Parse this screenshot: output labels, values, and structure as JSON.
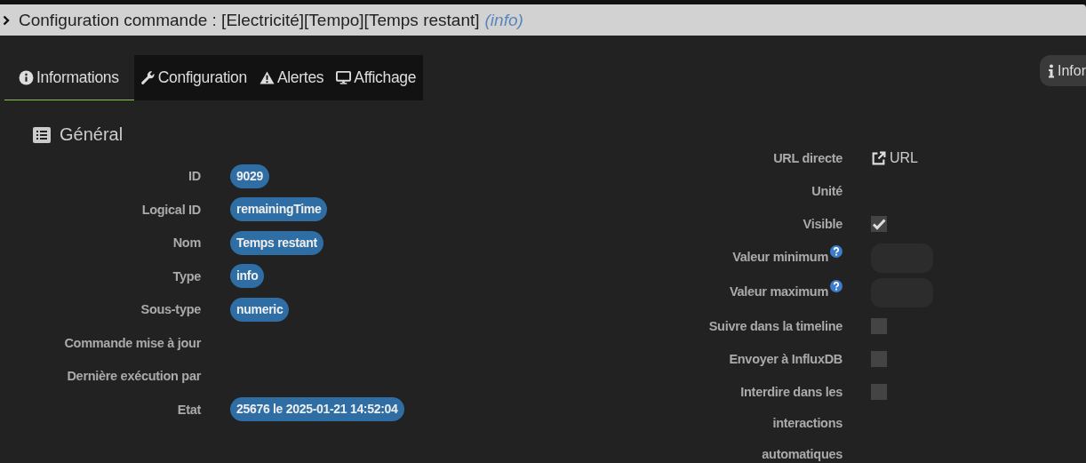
{
  "title_bar": {
    "title": "Configuration commande : [Electricité][Tempo][Temps restant]",
    "type_hint": "(info)"
  },
  "tabs": [
    {
      "label": "Informations",
      "kind": "info",
      "selected": true
    },
    {
      "label": "Configuration",
      "kind": "wrench",
      "selected": false
    },
    {
      "label": "Alertes",
      "kind": "warning",
      "selected": false
    },
    {
      "label": "Affichage",
      "kind": "monitor",
      "selected": false
    }
  ],
  "side_button": {
    "label": "Infor"
  },
  "section": {
    "title": "Général"
  },
  "general_fields": [
    {
      "label": "ID",
      "value": "9029"
    },
    {
      "label": "Logical ID",
      "value": "remainingTime"
    },
    {
      "label": "Nom",
      "value": "Temps restant"
    },
    {
      "label": "Type",
      "value": "info"
    },
    {
      "label": "Sous-type",
      "value": "numeric"
    },
    {
      "label": "Commande mise à jour"
    },
    {
      "label": "Dernière exécution par"
    },
    {
      "label": "Etat",
      "value": "25676 le 2025-01-21 14:52:04"
    }
  ],
  "settings": [
    {
      "kind": "link",
      "label": "URL directe",
      "value": "URL"
    },
    {
      "kind": "text",
      "label": "Unité"
    },
    {
      "kind": "checkbox",
      "label": "Visible",
      "checked": true
    },
    {
      "kind": "number",
      "label": "Valeur minimum",
      "help": true
    },
    {
      "kind": "number",
      "label": "Valeur maximum",
      "help": true
    },
    {
      "kind": "checkbox",
      "label": "Suivre dans la timeline",
      "checked": false
    },
    {
      "kind": "checkbox",
      "label": "Envoyer à InfluxDB",
      "checked": false
    },
    {
      "kind": "checkbox",
      "label": "Interdire dans les interactions automatiques",
      "checked": false
    }
  ]
}
